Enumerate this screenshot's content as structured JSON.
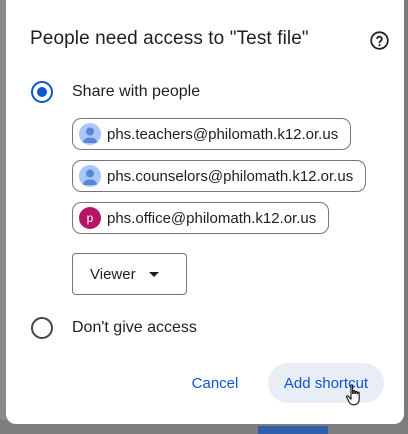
{
  "dialog": {
    "title": "People need access to \"Test file\"",
    "help_icon": "help-circle-icon"
  },
  "options": [
    {
      "label": "Share with people",
      "selected": true
    },
    {
      "label": "Don't give access",
      "selected": false
    }
  ],
  "recipients": [
    {
      "email": "phs.teachers@philomath.k12.or.us",
      "avatar": "person-icon"
    },
    {
      "email": "phs.counselors@philomath.k12.or.us",
      "avatar": "person-icon"
    },
    {
      "email": "phs.office@philomath.k12.or.us",
      "avatar_letter": "p"
    }
  ],
  "role": {
    "selected": "Viewer"
  },
  "buttons": {
    "cancel": "Cancel",
    "add_shortcut": "Add shortcut"
  },
  "colors": {
    "accent": "#0b57d0",
    "primary_button_bg": "#e9eef6"
  }
}
